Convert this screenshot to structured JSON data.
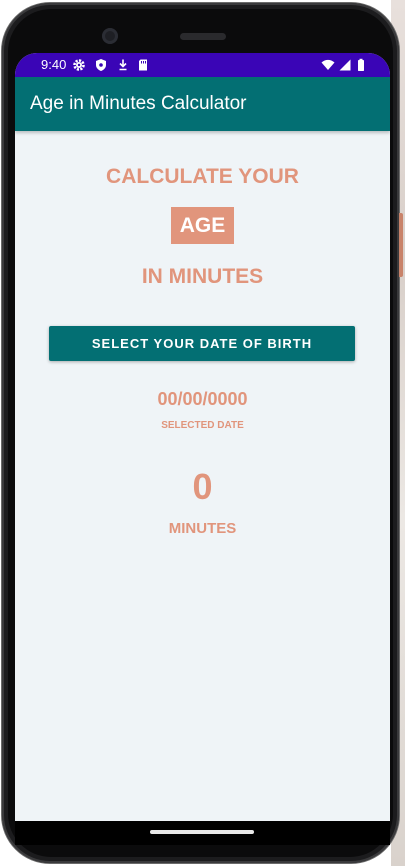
{
  "status_bar": {
    "time": "9:40",
    "icons_left": [
      "gear-icon",
      "shield-icon",
      "download-icon",
      "sd-card-icon"
    ],
    "icons_right": [
      "wifi-icon",
      "signal-icon",
      "battery-icon"
    ],
    "color": "#3a05b6"
  },
  "app_bar": {
    "title": "Age in Minutes Calculator",
    "color": "#036f73"
  },
  "main": {
    "heading_line1": "CALCULATE YOUR",
    "heading_age": "AGE",
    "heading_line3": "IN MINUTES",
    "select_button_label": "SELECT YOUR DATE OF BIRTH",
    "selected_date_value": "00/00/0000",
    "selected_date_label": "SELECTED DATE",
    "minutes_value": "0",
    "minutes_label": "MINUTES",
    "accent_color": "#e1957c",
    "background_color": "#eff4f7"
  }
}
